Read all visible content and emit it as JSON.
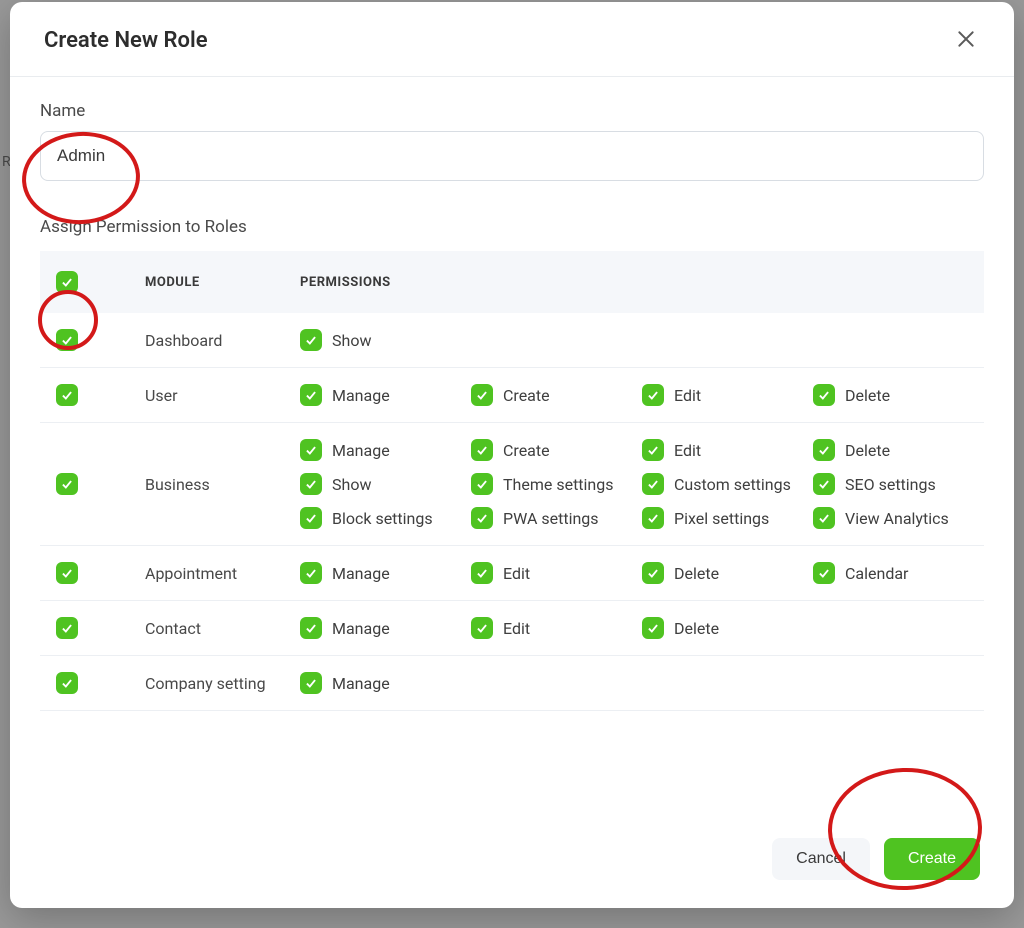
{
  "modal": {
    "title": "Create New Role",
    "nameLabel": "Name",
    "nameValue": "Admin",
    "assignLabel": "Assign Permission to Roles",
    "headers": {
      "module": "MODULE",
      "permissions": "PERMISSIONS"
    },
    "cancel": "Cancel",
    "create": "Create"
  },
  "rows": [
    {
      "module": "Dashboard",
      "perms": [
        "Show"
      ]
    },
    {
      "module": "User",
      "perms": [
        "Manage",
        "Create",
        "Edit",
        "Delete"
      ]
    },
    {
      "module": "Business",
      "perms": [
        "Manage",
        "Create",
        "Edit",
        "Delete",
        "Show",
        "Theme settings",
        "Custom settings",
        "SEO settings",
        "Block settings",
        "PWA settings",
        "Pixel settings",
        "View Analytics"
      ]
    },
    {
      "module": "Appointment",
      "perms": [
        "Manage",
        "Edit",
        "Delete",
        "Calendar"
      ]
    },
    {
      "module": "Contact",
      "perms": [
        "Manage",
        "Edit",
        "Delete"
      ]
    },
    {
      "module": "Company setting",
      "perms": [
        "Manage"
      ]
    }
  ],
  "backdrop": {
    "r": "R"
  }
}
